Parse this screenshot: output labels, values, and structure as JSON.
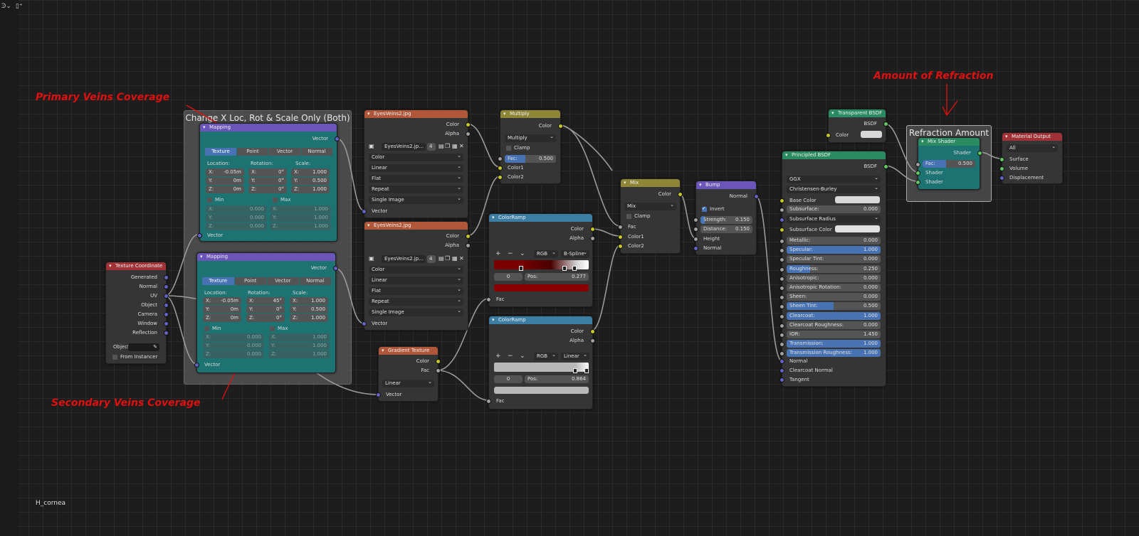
{
  "toolbar": {
    "icon1": "Ͽ⌄",
    "icon2": "▯⁺"
  },
  "material_name": "H_cornea",
  "annotations": {
    "primary": "Primary Veins Coverage",
    "secondary": "Secondary Veins Coverage",
    "refraction": "Amount of Refraction"
  },
  "frames": {
    "mapping_frame": "Change X Loc, Rot & Scale Only (Both)",
    "refraction_frame": "Refraction Amount"
  },
  "texture_coordinate": {
    "title": "Texture Coordinate",
    "outputs": [
      "Generated",
      "Normal",
      "UV",
      "Object",
      "Camera",
      "Window",
      "Reflection"
    ],
    "object_label": "Object",
    "from_instancer": "From Instancer"
  },
  "mapping1": {
    "title": "Mapping",
    "out": "Vector",
    "tabs": [
      "Texture",
      "Point",
      "Vector",
      "Normal"
    ],
    "loc_label": "Location:",
    "rot_label": "Rotation:",
    "scale_label": "Scale:",
    "loc": [
      "X:",
      "-0.05m",
      "Y:",
      "0m",
      "Z:",
      "0m"
    ],
    "rot": [
      "X:",
      "0°",
      "Y:",
      "0°",
      "Z:",
      "0°"
    ],
    "scale": [
      "X:",
      "1.000",
      "Y:",
      "0.500",
      "Z:",
      "1.000"
    ],
    "min": "Min",
    "max": "Max",
    "minv": [
      "X:",
      "0.000",
      "Y:",
      "0.000",
      "Z:",
      "0.000"
    ],
    "maxv": [
      "X:",
      "1.000",
      "Y:",
      "1.000",
      "Z:",
      "1.000"
    ],
    "in": "Vector"
  },
  "mapping2": {
    "title": "Mapping",
    "out": "Vector",
    "tabs": [
      "Texture",
      "Point",
      "Vector",
      "Normal"
    ],
    "loc_label": "Location:",
    "rot_label": "Rotation:",
    "scale_label": "Scale:",
    "loc": [
      "X:",
      "-0.05m",
      "Y:",
      "0m",
      "Z:",
      "0m"
    ],
    "rot": [
      "X:",
      "45°",
      "Y:",
      "0°",
      "Z:",
      "0°"
    ],
    "scale": [
      "X:",
      "1.000",
      "Y:",
      "0.500",
      "Z:",
      "1.000"
    ],
    "min": "Min",
    "max": "Max",
    "minv": [
      "X:",
      "0.000",
      "Y:",
      "0.000",
      "Z:",
      "0.000"
    ],
    "maxv": [
      "X:",
      "1.000",
      "Y:",
      "1.000",
      "Z:",
      "1.000"
    ],
    "in": "Vector"
  },
  "image1": {
    "title": "EyesVeins2.jpg",
    "out_color": "Color",
    "out_alpha": "Alpha",
    "file": "EyesVeins2.jp...",
    "users": "4",
    "opts": [
      "Color",
      "Linear",
      "Flat",
      "Repeat",
      "Single Image"
    ],
    "in": "Vector"
  },
  "image2": {
    "title": "EyesVeins2.jpg",
    "out_color": "Color",
    "out_alpha": "Alpha",
    "file": "EyesVeins2.jp...",
    "users": "4",
    "opts": [
      "Color",
      "Linear",
      "Flat",
      "Repeat",
      "Single Image"
    ],
    "in": "Vector"
  },
  "multiply": {
    "title": "Multiply",
    "out": "Color",
    "mode": "Multiply",
    "clamp": "Clamp",
    "fac_label": "Fac:",
    "fac": "0.500",
    "in1": "Color1",
    "in2": "Color2"
  },
  "colorramp1": {
    "title": "ColorRamp",
    "out_color": "Color",
    "out_alpha": "Alpha",
    "plus": "+",
    "minus": "−",
    "chev": "⌄",
    "mode": "RGB",
    "interp": "B-Spline",
    "index": "0",
    "pos_label": "Pos:",
    "pos": "0.277",
    "swatch": "#8a0000",
    "in": "Fac"
  },
  "colorramp2": {
    "title": "ColorRamp",
    "out_color": "Color",
    "out_alpha": "Alpha",
    "plus": "+",
    "minus": "−",
    "chev": "⌄",
    "mode": "RGB",
    "interp": "Linear",
    "index": "0",
    "pos_label": "Pos:",
    "pos": "0.864",
    "swatch": "#b8b8b8",
    "in": "Fac"
  },
  "gradient": {
    "title": "Gradient Texture",
    "out_color": "Color",
    "out_fac": "Fac",
    "type": "Linear",
    "in": "Vector"
  },
  "mix": {
    "title": "Mix",
    "out": "Color",
    "mode": "Mix",
    "clamp": "Clamp",
    "in_fac": "Fac",
    "in1": "Color1",
    "in2": "Color2"
  },
  "bump": {
    "title": "Bump",
    "out": "Normal",
    "invert": "Invert",
    "strength_label": "Strength:",
    "strength": "0.150",
    "distance_label": "Distance:",
    "distance": "0.150",
    "in_height": "Height",
    "in_normal": "Normal"
  },
  "principled": {
    "title": "Principled BSDF",
    "out": "BSDF",
    "dist": "GGX",
    "sss": "Christensen-Burley",
    "base_color": "Base Color",
    "subsurface": {
      "label": "Subsurface:",
      "value": "0.000"
    },
    "subsurface_radius": "Subsurface Radius",
    "subsurface_color": "Subsurface Color",
    "params": [
      {
        "label": "Metallic:",
        "value": "0.000",
        "fill": 0
      },
      {
        "label": "Specular:",
        "value": "1.000",
        "fill": 1
      },
      {
        "label": "Specular Tint:",
        "value": "0.000",
        "fill": 0
      },
      {
        "label": "Roughness:",
        "value": "0.250",
        "fill": 0.25
      },
      {
        "label": "Anisotropic:",
        "value": "0.000",
        "fill": 0
      },
      {
        "label": "Anisotropic Rotation:",
        "value": "0.000",
        "fill": 0
      },
      {
        "label": "Sheen:",
        "value": "0.000",
        "fill": 0
      },
      {
        "label": "Sheen Tint:",
        "value": "0.500",
        "fill": 0.5
      },
      {
        "label": "Clearcoat:",
        "value": "1.000",
        "fill": 1
      },
      {
        "label": "Clearcoat Roughness:",
        "value": "0.000",
        "fill": 0
      },
      {
        "label": "IOR:",
        "value": "1.450",
        "fill": 0
      },
      {
        "label": "Transmission:",
        "value": "1.000",
        "fill": 1
      },
      {
        "label": "Transmission Roughness:",
        "value": "1.000",
        "fill": 1
      }
    ],
    "in_normal": "Normal",
    "in_cc_normal": "Clearcoat Normal",
    "in_tangent": "Tangent"
  },
  "transparent": {
    "title": "Transparent BSDF",
    "out": "BSDF",
    "in": "Color"
  },
  "mix_shader": {
    "title": "Mix Shader",
    "out": "Shader",
    "fac_label": "Fac:",
    "fac": "0.500",
    "in1": "Shader",
    "in2": "Shader"
  },
  "output": {
    "title": "Material Output",
    "target": "All",
    "in_surface": "Surface",
    "in_volume": "Volume",
    "in_disp": "Displacement"
  },
  "colors": {
    "annotation": "#e01010",
    "socket_color": "#c7c729",
    "socket_float": "#a1a1a1",
    "socket_vector": "#6363c7",
    "socket_shader": "#63c763",
    "field_active": "#4772b3"
  }
}
